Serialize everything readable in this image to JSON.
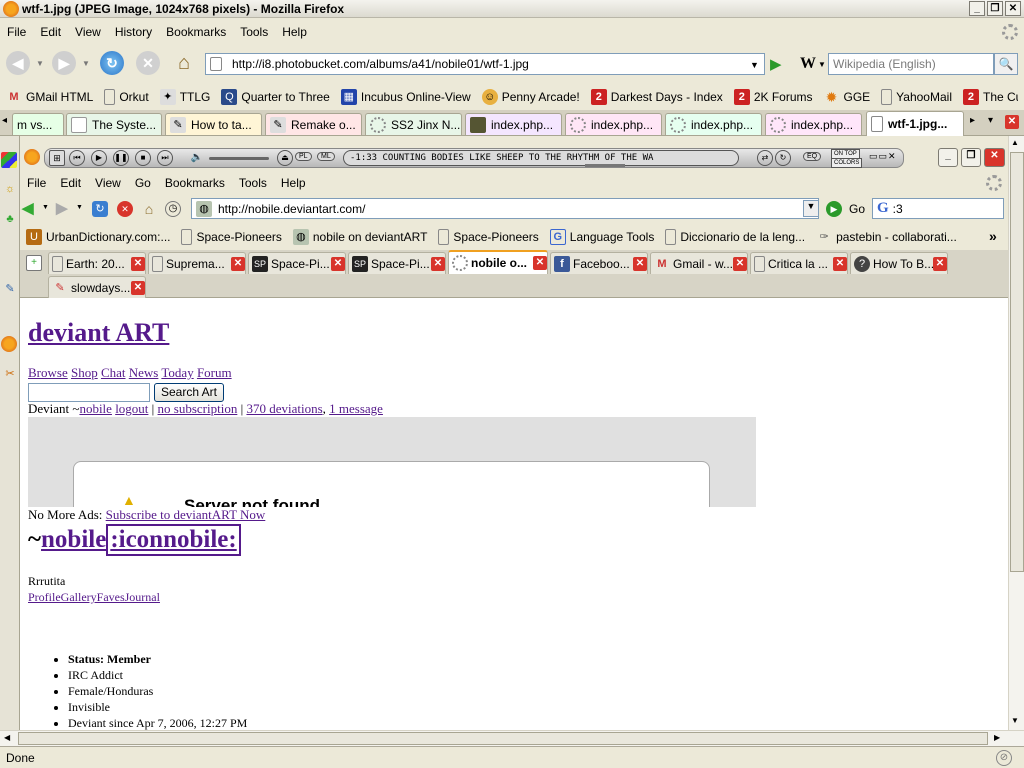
{
  "outer": {
    "title": "wtf-1.jpg (JPEG Image, 1024x768 pixels) - Mozilla Firefox",
    "menu": [
      "File",
      "Edit",
      "View",
      "History",
      "Bookmarks",
      "Tools",
      "Help"
    ],
    "url": "http://i8.photobucket.com/albums/a41/nobile01/wtf-1.jpg",
    "search_placeholder": "Wikipedia (English)",
    "search_engine_letter": "W",
    "bookmarks": [
      "GMail HTML",
      "Orkut",
      "TTLG",
      "Quarter to Three",
      "Incubus Online-View",
      "Penny Arcade!",
      "Darkest Days - Index",
      "2K Forums",
      "GGE",
      "YahooMail",
      "The Cult of Rapture"
    ],
    "tabs": [
      "m vs...",
      "The Syste...",
      "How to ta...",
      "Remake o...",
      "SS2 Jinx N...",
      "index.php...",
      "index.php...",
      "index.php...",
      "index.php...",
      "wtf-1.jpg..."
    ],
    "tab_scroll_left": "◂",
    "tab_scroll_right": "▸",
    "tab_list": "▾",
    "status": "Done"
  },
  "player": {
    "track": "-1:33 COUNTING BODIES LIKE SHEEP TO THE RHYTHM OF THE WA",
    "pl": "PL",
    "ml": "ML",
    "eq": "EQ",
    "on_top": "ON TOP",
    "colors": "COLORS"
  },
  "inner": {
    "menu": [
      "File",
      "Edit",
      "View",
      "Go",
      "Bookmarks",
      "Tools",
      "Help"
    ],
    "url": "http://nobile.deviantart.com/",
    "go_label": "Go",
    "search_letter": "G",
    "search_value": ":3",
    "bookmarks": [
      "UrbanDictionary.com:...",
      "Space-Pioneers",
      "nobile on deviantART",
      "Space-Pioneers",
      "Language Tools",
      "Diccionario de la leng...",
      "pastebin - collaborati..."
    ],
    "bookmarks_more": "»",
    "tabs": [
      "Earth: 20...",
      "Suprema...",
      "Space-Pi...",
      "Space-Pi...",
      "nobile o...",
      "Faceboo...",
      "Gmail - w...",
      "Critica la ...",
      "How To B...",
      "slowdays..."
    ]
  },
  "page": {
    "heading": "deviant ART",
    "nav": [
      "Browse",
      "Shop",
      "Chat",
      "News",
      "Today",
      "Forum"
    ],
    "search_button": "Search Art",
    "user_prefix": "Deviant ~",
    "user": "nobile",
    "logout": "logout",
    "subscription": "no subscription",
    "deviations": "370 deviations",
    "message": "1 message",
    "error_title": "Server not found",
    "ads_label": "No More Ads:",
    "ads_link": "Subscribe to deviantART Now",
    "profile_tilde": "~",
    "profile_name": "nobile",
    "profile_icon_text": ":iconnobile:",
    "tagline": "Rrrutita",
    "profile_links": "ProfileGalleryFavesJournal",
    "info": [
      "Status: Member",
      "IRC Addict",
      "Female/Honduras",
      "Invisible",
      "Deviant since Apr 7, 2006, 12:27 PM"
    ]
  },
  "colors": {
    "link": "#551a8b",
    "error_red": "#d8342b",
    "go_green": "#2b9a2b"
  }
}
